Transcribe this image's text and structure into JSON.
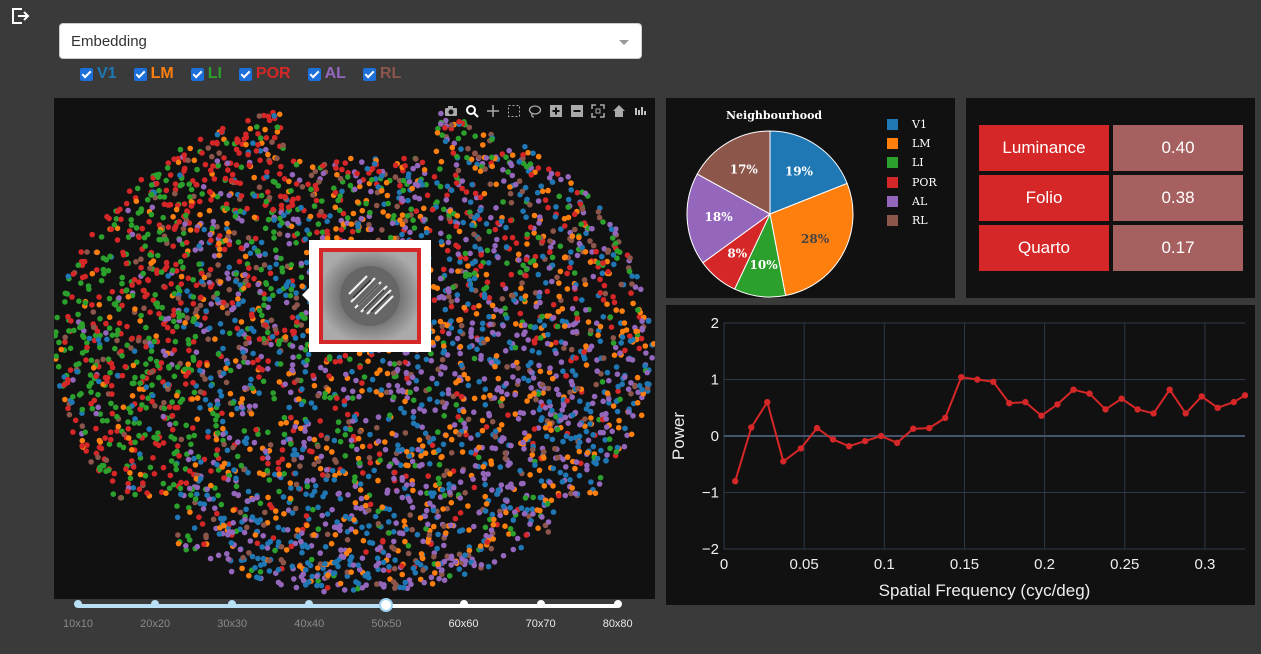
{
  "dropdown": {
    "value": "Embedding"
  },
  "areas": [
    {
      "label": "V1",
      "color": "#1f77b4",
      "checked": true
    },
    {
      "label": "LM",
      "color": "#ff7f0e",
      "checked": true
    },
    {
      "label": "LI",
      "color": "#2ca02c",
      "checked": true
    },
    {
      "label": "POR",
      "color": "#d62728",
      "checked": true
    },
    {
      "label": "AL",
      "color": "#9467bd",
      "checked": true
    },
    {
      "label": "RL",
      "color": "#8c564b",
      "checked": true
    }
  ],
  "slider": {
    "labels": [
      "10x10",
      "20x20",
      "30x30",
      "40x40",
      "50x50",
      "60x60",
      "70x70",
      "80x80"
    ],
    "selected": "50x50"
  },
  "table": [
    {
      "key": "Luminance",
      "value": "0.40"
    },
    {
      "key": "Folio",
      "value": "0.38"
    },
    {
      "key": "Quarto",
      "value": "0.17"
    }
  ],
  "chart_data": [
    {
      "type": "scatter",
      "title": "",
      "series_names": [
        "V1",
        "LM",
        "LI",
        "POR",
        "AL",
        "RL"
      ],
      "note_points": "dense 2D embedding cloud of colored points per area"
    },
    {
      "type": "pie",
      "title": "Neighbourhood",
      "labels": [
        "V1",
        "LM",
        "LI",
        "POR",
        "AL",
        "RL"
      ],
      "values": [
        19,
        28,
        10,
        8,
        18,
        17
      ],
      "colors": [
        "#1f77b4",
        "#ff7f0e",
        "#2ca02c",
        "#d62728",
        "#9467bd",
        "#8c564b"
      ],
      "legend": "right"
    },
    {
      "type": "line",
      "xlabel": "Spatial Frequency (cyc/deg)",
      "ylabel": "Power",
      "xlim": [
        0,
        0.325
      ],
      "ylim": [
        -2,
        2
      ],
      "xticks": [
        "0",
        "0.05",
        "0.1",
        "0.15",
        "0.2",
        "0.25",
        "0.3"
      ],
      "yticks": [
        "2",
        "1",
        "0",
        "−1",
        "−2"
      ],
      "x": [
        0.007,
        0.017,
        0.027,
        0.037,
        0.048,
        0.058,
        0.068,
        0.078,
        0.088,
        0.098,
        0.108,
        0.118,
        0.128,
        0.138,
        0.148,
        0.158,
        0.168,
        0.178,
        0.188,
        0.198,
        0.208,
        0.218,
        0.228,
        0.238,
        0.248,
        0.258,
        0.268,
        0.278,
        0.288,
        0.298,
        0.308,
        0.318,
        0.325
      ],
      "y": [
        -0.8,
        0.15,
        0.6,
        -0.45,
        -0.22,
        0.14,
        -0.06,
        -0.18,
        -0.09,
        0.0,
        -0.12,
        0.13,
        0.14,
        0.32,
        1.04,
        1.0,
        0.96,
        0.58,
        0.6,
        0.36,
        0.56,
        0.82,
        0.75,
        0.47,
        0.66,
        0.47,
        0.4,
        0.82,
        0.4,
        0.7,
        0.5,
        0.6,
        0.72
      ],
      "color": "#d62728",
      "grid": true
    }
  ]
}
